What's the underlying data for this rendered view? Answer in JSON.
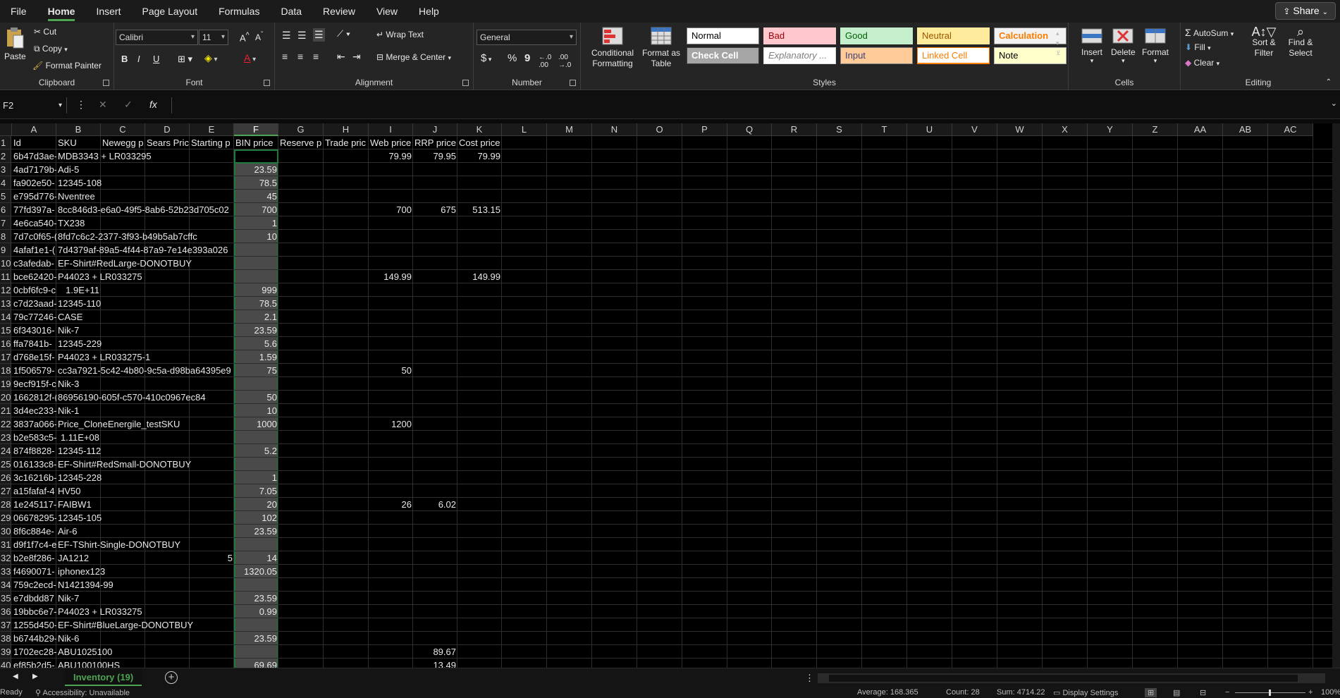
{
  "menu": {
    "items": [
      "File",
      "Home",
      "Insert",
      "Page Layout",
      "Formulas",
      "Data",
      "Review",
      "View",
      "Help"
    ],
    "active": "Home",
    "share": "Share"
  },
  "ribbon": {
    "clipboard": {
      "label": "Clipboard",
      "paste": "Paste",
      "cut": "Cut",
      "copy": "Copy",
      "format_painter": "Format Painter"
    },
    "font": {
      "label": "Font",
      "name": "Calibri",
      "size": "11",
      "bold": "B",
      "italic": "I",
      "underline": "U"
    },
    "alignment": {
      "label": "Alignment",
      "wrap_text": "Wrap Text",
      "merge_center": "Merge & Center"
    },
    "number": {
      "label": "Number",
      "format": "General",
      "currency": "$",
      "percent": "%",
      "comma": "9"
    },
    "styles": {
      "label": "Styles",
      "conditional": "Conditional Formatting",
      "format_table": "Format as Table",
      "cells": [
        {
          "name": "Normal",
          "bg": "#ffffff",
          "fg": "#000000",
          "border": "#777777"
        },
        {
          "name": "Bad",
          "bg": "#ffc7ce",
          "fg": "#9c0006",
          "border": "#ffc7ce"
        },
        {
          "name": "Good",
          "bg": "#c6efce",
          "fg": "#006100",
          "border": "#c6efce"
        },
        {
          "name": "Neutral",
          "bg": "#ffeb9c",
          "fg": "#9c5700",
          "border": "#ffeb9c"
        },
        {
          "name": "Calculation",
          "bg": "#f2f2f2",
          "fg": "#fa7d00",
          "border": "#7f7f7f"
        },
        {
          "name": "Check Cell",
          "bg": "#a5a5a5",
          "fg": "#ffffff",
          "border": "#3f3f3f"
        },
        {
          "name": "Explanatory ...",
          "bg": "#ffffff",
          "fg": "#7f7f7f",
          "border": "#dddddd"
        },
        {
          "name": "Input",
          "bg": "#ffcc99",
          "fg": "#3f3f76",
          "border": "#7f7f7f"
        },
        {
          "name": "Linked Cell",
          "bg": "#ffffff",
          "fg": "#fa7d00",
          "border": "#ff8001"
        },
        {
          "name": "Note",
          "bg": "#ffffcc",
          "fg": "#000000",
          "border": "#b2b2b2"
        }
      ]
    },
    "cells": {
      "label": "Cells",
      "insert": "Insert",
      "delete": "Delete",
      "format": "Format"
    },
    "editing": {
      "label": "Editing",
      "autosum": "AutoSum",
      "fill": "Fill",
      "clear": "Clear",
      "sort": "Sort & Filter",
      "find": "Find & Select"
    }
  },
  "formula_bar": {
    "name_box": "F2",
    "formula": ""
  },
  "columns": [
    "A",
    "B",
    "C",
    "D",
    "E",
    "F",
    "G",
    "H",
    "I",
    "J",
    "K",
    "L",
    "M",
    "N",
    "O",
    "P",
    "Q",
    "R",
    "S",
    "T",
    "U",
    "V",
    "W",
    "X",
    "Y",
    "Z",
    "AA",
    "AB",
    "AC"
  ],
  "selected_column": "F",
  "headers": [
    "Id",
    "SKU",
    "Newegg p",
    "Sears Pric",
    "Starting p",
    "BIN price",
    "Reserve p",
    "Trade pric",
    "Web price",
    "RRP price",
    "Cost price"
  ],
  "rows": [
    {
      "A": "6b47d3ae-",
      "B": "MDB3343 + LR033295",
      "F": "",
      "I": "79.99",
      "J": "79.95",
      "K": "79.99"
    },
    {
      "A": "4ad7179b-",
      "B": "Adi-5",
      "F": "23.59"
    },
    {
      "A": "fa902e50-",
      "B": "12345-108",
      "F": "78.5"
    },
    {
      "A": "e795d776-",
      "B": "Nventree",
      "F": "45"
    },
    {
      "A": "77fd397a-",
      "B": "8cc846d3-e6a0-49f5-8ab6-52b23d705c02",
      "F": "700",
      "I": "700",
      "J": "675",
      "K": "513.15"
    },
    {
      "A": "4e6ca540-",
      "B": "TX238",
      "F": "1"
    },
    {
      "A": "7d7c0f65-(",
      "B": "8fd7c6c2-2377-3f93-b49b5ab7cffc",
      "F": "10"
    },
    {
      "A": "4afaf1e1-(",
      "B": "7d4379af-89a5-4f44-87a9-7e14e393a026"
    },
    {
      "A": "c3afedab-",
      "B": "EF-Shirt#RedLarge-DONOTBUY"
    },
    {
      "A": "bce62420-",
      "B": "P44023 + LR033275",
      "I": "149.99",
      "K": "149.99"
    },
    {
      "A": "0cbf6fc9-c",
      "B": "1.9E+11",
      "Bnum": true,
      "F": "999"
    },
    {
      "A": "c7d23aad-",
      "B": "12345-110",
      "F": "78.5"
    },
    {
      "A": "79c77246-",
      "B": "CASE",
      "F": "2.1"
    },
    {
      "A": "6f343016-",
      "B": "Nik-7",
      "F": "23.59"
    },
    {
      "A": "ffa7841b-",
      "B": "12345-229",
      "F": "5.6"
    },
    {
      "A": "d768e15f-",
      "B": "P44023 + LR033275-1",
      "F": "1.59"
    },
    {
      "A": "1f506579-",
      "B": "cc3a7921-5c42-4b80-9c5a-d98ba64395e9",
      "F": "75",
      "I": "50"
    },
    {
      "A": "9ecf915f-c",
      "B": "Nik-3"
    },
    {
      "A": "1662812f-(",
      "B": "86956190-605f-c570-410c0967ec84",
      "F": "50"
    },
    {
      "A": "3d4ec233-",
      "B": "Nik-1",
      "F": "10"
    },
    {
      "A": "3837a066-",
      "B": "Price_CloneEnergile_testSKU",
      "F": "1000",
      "I": "1200"
    },
    {
      "A": "b2e583c5-",
      "B": "1.11E+08",
      "Bnum": true
    },
    {
      "A": "874f8828-",
      "B": "12345-112",
      "F": "5.2"
    },
    {
      "A": "016133c8-",
      "B": "EF-Shirt#RedSmall-DONOTBUY"
    },
    {
      "A": "3c16216b-",
      "B": "12345-228",
      "F": "1"
    },
    {
      "A": "a15fafaf-4",
      "B": "HV50",
      "F": "7.05"
    },
    {
      "A": "1e245117-",
      "B": "FAIBW1",
      "F": "20",
      "I": "26",
      "J": "6.02"
    },
    {
      "A": "06678295-",
      "B": "12345-105",
      "F": "102"
    },
    {
      "A": "8f6c884e-",
      "B": "Air-6",
      "F": "23.59"
    },
    {
      "A": "d9f1f7c4-e",
      "B": "EF-TShirt-Single-DONOTBUY"
    },
    {
      "A": "b2e8f286-",
      "B": "JA1212",
      "E": "5",
      "F": "14"
    },
    {
      "A": "f4690071-",
      "B": "iphonex123",
      "F": "1320.05"
    },
    {
      "A": "759c2ecd-",
      "B": "N1421394-99"
    },
    {
      "A": "e7dbdd87",
      "B": "Nik-7",
      "F": "23.59"
    },
    {
      "A": "19bbc6e7-",
      "B": "P44023 + LR033275",
      "F": "0.99"
    },
    {
      "A": "1255d450-",
      "B": "EF-Shirt#BlueLarge-DONOTBUY"
    },
    {
      "A": "b6744b29-",
      "B": "Nik-6",
      "F": "23.59"
    },
    {
      "A": "1702ec28-",
      "B": "ABU1025100",
      "J": "89.67"
    },
    {
      "A": "ef85b2d5-",
      "B": "ABU100100HS",
      "F": "69.69",
      "J": "13.49"
    }
  ],
  "sheet_tab": "Inventory (19)",
  "status": {
    "ready": "Ready",
    "accessibility": "Accessibility: Unavailable",
    "average": "Average: 168.365",
    "count": "Count: 28",
    "sum": "Sum: 4714.22",
    "display_settings": "Display Settings",
    "zoom": "100%"
  }
}
